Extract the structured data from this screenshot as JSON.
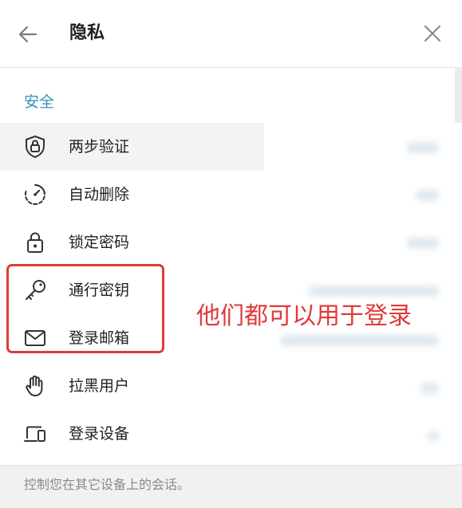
{
  "header": {
    "title": "隐私",
    "back_icon": "arrow-left-icon",
    "close_icon": "close-icon"
  },
  "section": {
    "title": "安全"
  },
  "items": [
    {
      "label": "两步验证",
      "icon": "shield-lock-icon"
    },
    {
      "label": "自动删除",
      "icon": "timer-icon"
    },
    {
      "label": "锁定密码",
      "icon": "padlock-icon"
    },
    {
      "label": "通行密钥",
      "icon": "key-icon"
    },
    {
      "label": "登录邮箱",
      "icon": "mail-icon"
    },
    {
      "label": "拉黑用户",
      "icon": "hand-icon"
    },
    {
      "label": "登录设备",
      "icon": "devices-icon"
    }
  ],
  "annotation": {
    "text": "他们都可以用于登录",
    "color": "#e03a3a"
  },
  "footer": {
    "text": "控制您在其它设备上的会话。"
  },
  "colors": {
    "accent": "#3a8fb7",
    "highlight": "#e03a3a"
  }
}
